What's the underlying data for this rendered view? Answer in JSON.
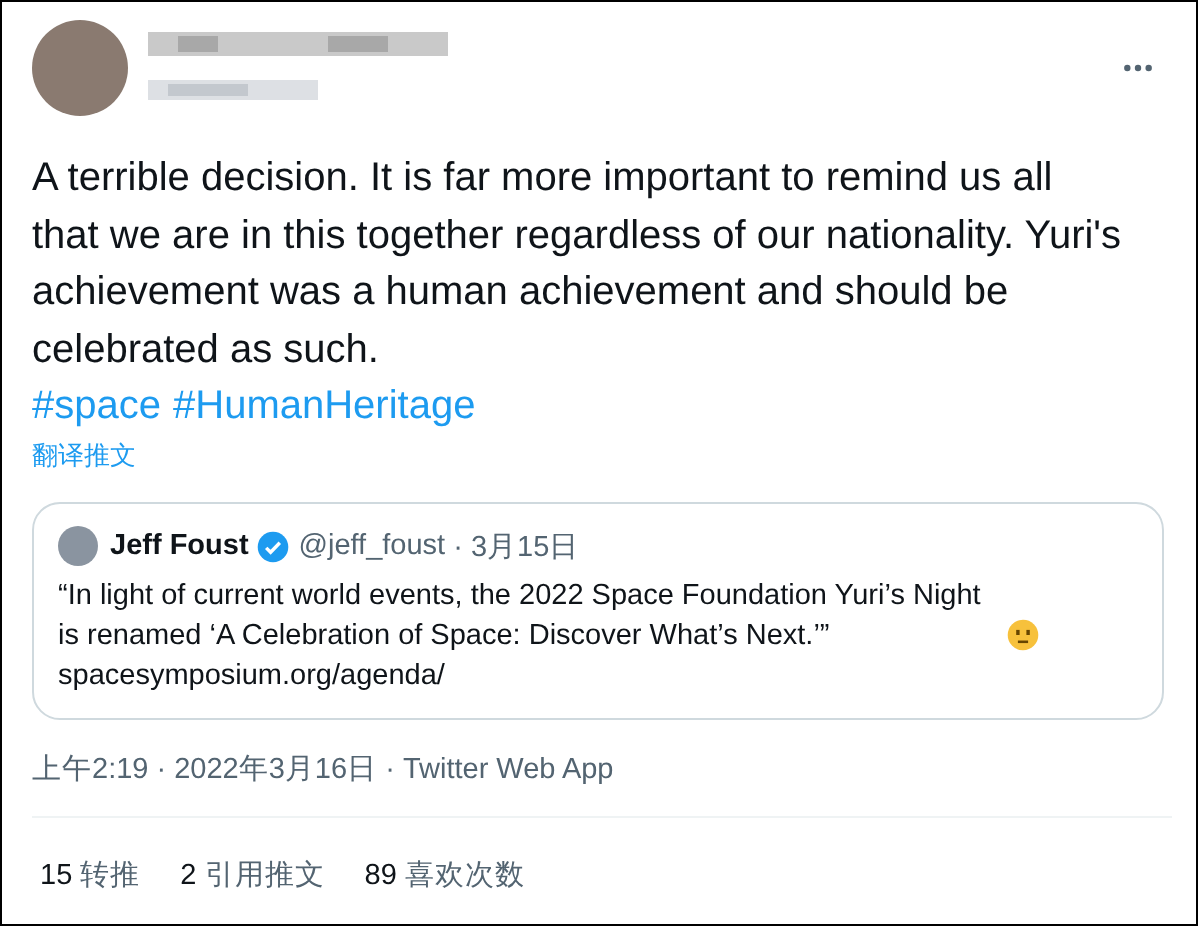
{
  "tweet": {
    "text": "A terrible decision. It is far more important to remind us all that we are in this together regardless of our nationality. Yuri's achievement was a human achievement and should be celebrated as such.",
    "hashtags": [
      "#space",
      "#HumanHeritage"
    ],
    "translate": "翻译推文",
    "quote": {
      "name": "Jeff Foust",
      "verified": true,
      "handle": "@jeff_foust",
      "date": "· 3月15日",
      "text": "“In light of current world events, the 2022 Space Foundation Yuri’s Night is renamed ‘A Celebration of Space: Discover What’s Next.’”",
      "link": "spacesymposium.org/agenda/"
    },
    "meta": "上午2:19 · 2022年3月16日 · Twitter Web App",
    "stats": [
      {
        "count": "15",
        "label": "转推"
      },
      {
        "count": "2",
        "label": "引用推文"
      },
      {
        "count": "89",
        "label": "喜欢次数"
      }
    ]
  }
}
